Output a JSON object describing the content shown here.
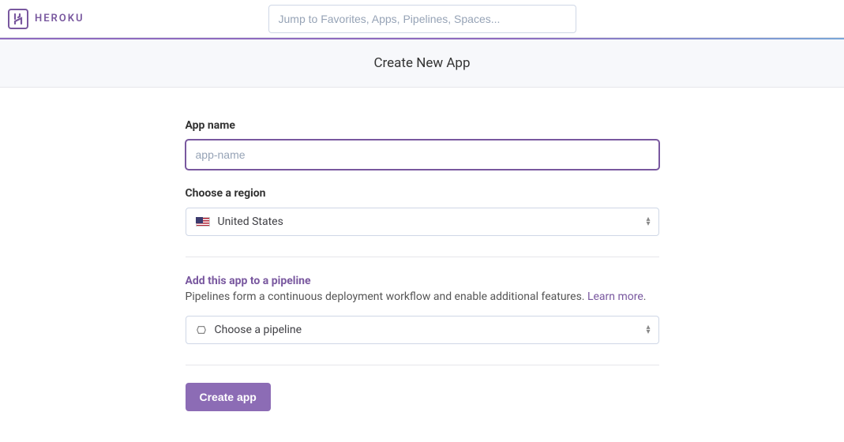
{
  "header": {
    "brand": "HEROKU",
    "search_placeholder": "Jump to Favorites, Apps, Pipelines, Spaces..."
  },
  "subheader": {
    "title": "Create New App"
  },
  "form": {
    "app_name": {
      "label": "App name",
      "placeholder": "app-name",
      "value": ""
    },
    "region": {
      "label": "Choose a region",
      "selected": "United States"
    },
    "pipeline": {
      "title": "Add this app to a pipeline",
      "description": "Pipelines form a continuous deployment workflow and enable additional features. ",
      "learn_more": "Learn more",
      "selected": "Choose a pipeline"
    },
    "submit_label": "Create app"
  }
}
